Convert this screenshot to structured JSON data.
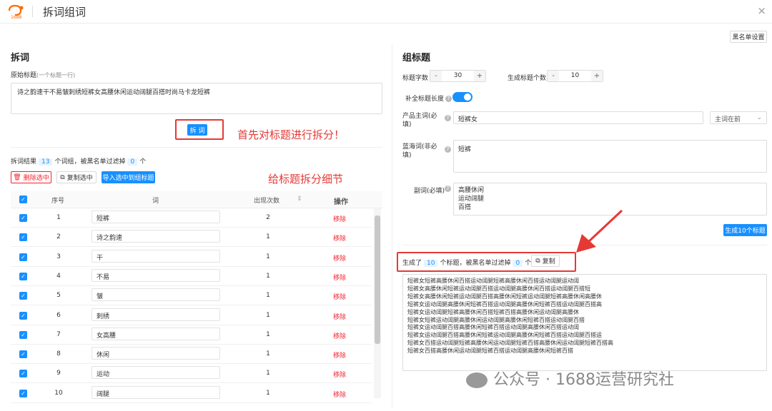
{
  "header": {
    "title": "拆词组词",
    "logo_text": "1688",
    "close": "×"
  },
  "blacklist_button": "黑名单设置",
  "split": {
    "title": "拆词",
    "original_label": "原始标题",
    "original_hint": "(一个标题一行)",
    "original_value": "诗之韵速干不易皱刺绣短裤女高腰休闲运动阔腿百搭时尚马卡龙短裤",
    "split_button": "拆 词",
    "annotation1": "首先对标题进行拆分！",
    "result_prefix": "拆词结果",
    "result_count": "13",
    "result_mid": "个词组，被黑名单过滤掉",
    "filtered_count": "0",
    "result_suffix": "个",
    "delete_btn": "删除选中",
    "copy_btn": "复制选中",
    "import_btn": "导入选中到组标题",
    "annotation2": "给标题拆分细节"
  },
  "table": {
    "headers": {
      "index": "序号",
      "word": "词",
      "count": "出现次数",
      "op": "操作"
    },
    "op_label": "移除",
    "rows": [
      {
        "index": "1",
        "word": "短裤",
        "count": "2"
      },
      {
        "index": "2",
        "word": "诗之韵速",
        "count": "1"
      },
      {
        "index": "3",
        "word": "干",
        "count": "1"
      },
      {
        "index": "4",
        "word": "不易",
        "count": "1"
      },
      {
        "index": "5",
        "word": "皱",
        "count": "1"
      },
      {
        "index": "6",
        "word": "刺绣",
        "count": "1"
      },
      {
        "index": "7",
        "word": "女高腰",
        "count": "1"
      },
      {
        "index": "8",
        "word": "休闲",
        "count": "1"
      },
      {
        "index": "9",
        "word": "运动",
        "count": "1"
      },
      {
        "index": "10",
        "word": "阔腿",
        "count": "1"
      }
    ]
  },
  "compose": {
    "title": "组标题",
    "char_label": "标题字数",
    "char_value": "30",
    "gen_label": "生成标题个数",
    "gen_value": "10",
    "fill_label": "补全标题长度",
    "main_word_label": "产品主词(必填)",
    "main_word_value": "短裤女",
    "main_word_select": "主词在前",
    "blue_word_label": "蓝海词(非必填)",
    "blue_word_value": "短裤",
    "sub_word_label": "副词(必填)",
    "sub_words": [
      "高腰休闲",
      "运动阔腿",
      "百搭"
    ],
    "generate_btn": "生成10个标题",
    "gen_prefix": "生成了",
    "gen_count": "10",
    "gen_mid": "个标题，被黑名单过滤掉",
    "gen_filtered": "0",
    "gen_suffix": "个",
    "copy_btn": "复制",
    "results": [
      "短裤女短裤高腰休闲百搭运动阔腿短裤高腰休闲百搭运动阔腿运动阔",
      "短裤女高腰休闲短裤运动阔腿百搭运动阔腿高腰休闲百搭运动阔腿百搭短",
      "短裤女高腰休闲短裤运动阔腿百搭高腰休闲短裤运动阔腿短裤高腰休闲高腰休",
      "短裤女运动阔腿高腰休闲短裤百搭运动阔腿高腰休闲短裤百搭运动阔腿百搭高",
      "短裤女运动阔腿短裤高腰休闲百搭短裤百搭高腰休闲运动阔腿高腰休",
      "短裤女短裤运动阔腿高腰休闲运动阔腿高腰休闲短裤百搭运动阔腿百搭",
      "短裤女运动阔腿百搭高腰休闲短裤百搭运动阔腿高腰休闲百搭运动阔",
      "短裤女运动阔腿百搭高腰休闲短裤运动阔腿高腰休闲短裤百搭运动阔腿百搭运",
      "短裤女百搭运动阔腿短裤高腰休闲运动阔腿短裤百搭高腰休闲运动阔腿短裤百搭高",
      "短裤女百搭高腰休闲运动阔腿短裤百搭运动阔腿高腰休闲短裤百搭"
    ]
  },
  "watermark": "公众号 · 1688运营研究社",
  "colors": {
    "accent": "#1890ff",
    "annotation": "#e53935",
    "danger": "#f5222d"
  }
}
